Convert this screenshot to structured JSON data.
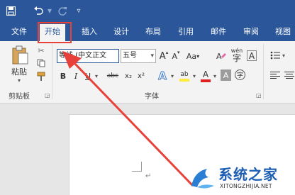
{
  "quick_access": {
    "icons": [
      "save-icon",
      "undo-icon",
      "redo-icon",
      "customize-dropdown-icon"
    ]
  },
  "tabs": [
    {
      "label": "文件",
      "active": false
    },
    {
      "label": "开始",
      "active": true
    },
    {
      "label": "插入",
      "active": false
    },
    {
      "label": "设计",
      "active": false
    },
    {
      "label": "布局",
      "active": false
    },
    {
      "label": "引用",
      "active": false
    },
    {
      "label": "邮件",
      "active": false
    },
    {
      "label": "审阅",
      "active": false
    },
    {
      "label": "视图",
      "active": false
    }
  ],
  "clipboard": {
    "paste_label": "粘贴",
    "group_label": "剪贴板"
  },
  "font": {
    "font_name": "等线 (中文正文",
    "font_size": "五号",
    "group_label": "字体",
    "grow_label": "A",
    "shrink_label": "A",
    "case_label": "Aa",
    "phonetic_label": "wén",
    "bold": "B",
    "italic": "I",
    "underline": "U",
    "strike": "abc",
    "subscript": "x₂",
    "superscript": "x²",
    "effects": "A",
    "highlight": "ab",
    "font_color": "A",
    "shading": "A",
    "enclose": "字"
  },
  "document": {
    "paragraph_mark": "↵"
  },
  "watermark": {
    "title": "系统之家",
    "url": "XITONGZHIJIA.NET"
  },
  "colors": {
    "ribbon_blue": "#2b579a",
    "annotation_red": "#e8413a",
    "highlight_yellow": "#ffeb3b",
    "font_color_red": "#e02020"
  }
}
